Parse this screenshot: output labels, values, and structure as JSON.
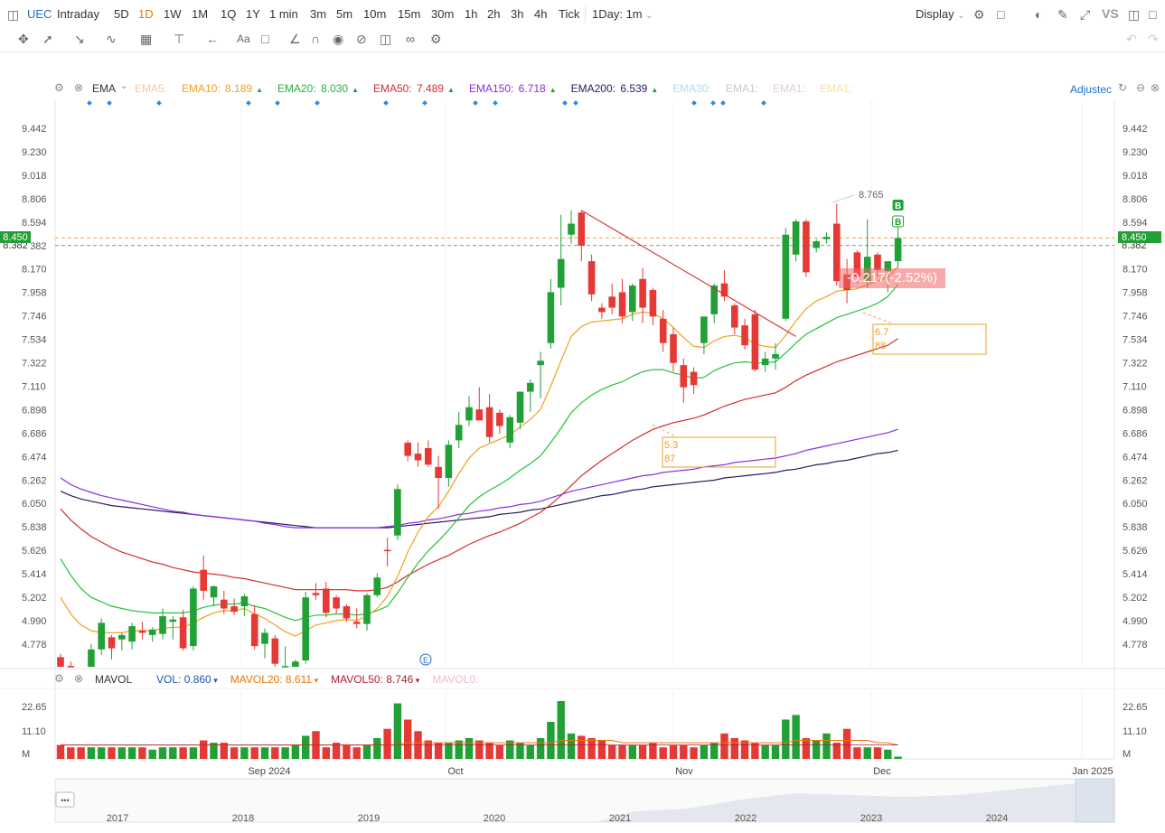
{
  "toolbar": {
    "symbol": "UEC",
    "timeframes": [
      "Intraday",
      "5D",
      "1D",
      "1W",
      "1M",
      "1Q",
      "1Y",
      "1 min",
      "3m",
      "5m",
      "10m",
      "15m",
      "30m",
      "1h",
      "2h",
      "3h",
      "4h",
      "Tick"
    ],
    "active_timeframe": "1D",
    "interval_select": "1Day: 1m",
    "display_label": "Display",
    "vs_label": "VS",
    "accent_color": "#e8760b"
  },
  "indicator_bar": {
    "name": "EMA",
    "items": [
      {
        "label": "EMA5:",
        "value": "",
        "color": "#f5c8a0"
      },
      {
        "label": "EMA10:",
        "value": "8.189",
        "color": "#f0a020",
        "arrow": "up"
      },
      {
        "label": "EMA20:",
        "value": "8.030",
        "color": "#22b33a",
        "arrow": "up"
      },
      {
        "label": "EMA50:",
        "value": "7.489",
        "color": "#d42c2c",
        "arrow": "up"
      },
      {
        "label": "EMA150:",
        "value": "6.718",
        "color": "#8a2be2",
        "arrow": "up"
      },
      {
        "label": "EMA200:",
        "value": "6.539",
        "color": "#2a1a5e",
        "arrow": "up"
      },
      {
        "label": "EMA30:",
        "value": "",
        "color": "#a8e0f0"
      },
      {
        "label": "EMA1:",
        "value": "",
        "color": "#c8c8c8"
      },
      {
        "label": "EMA1:",
        "value": "",
        "color": "#e8c8d8"
      },
      {
        "label": "EMA1:",
        "value": "",
        "color": "#f5e0a0"
      }
    ],
    "adjusted_label": "Adjustec"
  },
  "volume_bar": {
    "name": "MAVOL",
    "items": [
      {
        "label": "VOL:",
        "value": "0.860",
        "color": "#1a55b5"
      },
      {
        "label": "MAVOL20:",
        "value": "8.611",
        "color": "#e8760b"
      },
      {
        "label": "MAVOL50:",
        "value": "8.746",
        "color": "#b01c2e"
      },
      {
        "label": "MAVOL0:",
        "value": "",
        "color": "#f0b8c8"
      }
    ]
  },
  "price_tags": {
    "last_price": "8.450",
    "last_price_color": "#21a035",
    "left_tag_color": "#21a035",
    "right_tag_overlap": "8.382",
    "change_label": "-0.217(-2.52%)",
    "high_label": "8.765"
  },
  "annotations": {
    "box1": [
      "5.3",
      "87"
    ],
    "box2": [
      "6.7",
      "88"
    ],
    "markers": [
      "B",
      "B"
    ],
    "event_icon": "E"
  },
  "navigator": {
    "years": [
      "2017",
      "2018",
      "2019",
      "2020",
      "2021",
      "2022",
      "2023",
      "2024"
    ],
    "menu": "•••"
  },
  "chart_data": {
    "type": "candlestick",
    "price_axis_ticks": [
      9.442,
      9.23,
      9.018,
      8.806,
      8.594,
      8.382,
      8.17,
      7.958,
      7.746,
      7.534,
      7.322,
      7.11,
      6.898,
      6.686,
      6.474,
      6.262,
      6.05,
      5.838,
      5.626,
      5.414,
      5.202,
      4.99,
      4.778
    ],
    "volume_axis_ticks": [
      "22.65",
      "11.10",
      "M"
    ],
    "x_axis_labels": [
      "Sep 2024",
      "Oct",
      "Nov",
      "Dec",
      "Jan 2025"
    ],
    "up_color": "#21a035",
    "down_color": "#e53935",
    "candles": [
      {
        "o": 4.66,
        "h": 4.69,
        "l": 4.38,
        "c": 4.44
      },
      {
        "o": 4.58,
        "h": 4.62,
        "l": 4.38,
        "c": 4.43
      },
      {
        "o": 4.54,
        "h": 4.62,
        "l": 4.29,
        "c": 4.36
      },
      {
        "o": 4.4,
        "h": 4.78,
        "l": 4.35,
        "c": 4.73
      },
      {
        "o": 4.73,
        "h": 5.01,
        "l": 4.68,
        "c": 4.97
      },
      {
        "o": 4.84,
        "h": 4.86,
        "l": 4.64,
        "c": 4.74
      },
      {
        "o": 4.82,
        "h": 4.88,
        "l": 4.72,
        "c": 4.86
      },
      {
        "o": 4.8,
        "h": 4.97,
        "l": 4.73,
        "c": 4.94
      },
      {
        "o": 4.9,
        "h": 4.98,
        "l": 4.82,
        "c": 4.88
      },
      {
        "o": 4.86,
        "h": 4.93,
        "l": 4.8,
        "c": 4.91
      },
      {
        "o": 4.87,
        "h": 5.1,
        "l": 4.82,
        "c": 5.03
      },
      {
        "o": 4.98,
        "h": 5.03,
        "l": 4.82,
        "c": 5.0
      },
      {
        "o": 5.02,
        "h": 5.09,
        "l": 4.72,
        "c": 4.74
      },
      {
        "o": 4.76,
        "h": 5.3,
        "l": 4.72,
        "c": 5.28
      },
      {
        "o": 5.45,
        "h": 5.58,
        "l": 5.18,
        "c": 5.26
      },
      {
        "o": 5.2,
        "h": 5.31,
        "l": 5.12,
        "c": 5.3
      },
      {
        "o": 5.18,
        "h": 5.26,
        "l": 5.05,
        "c": 5.1
      },
      {
        "o": 5.12,
        "h": 5.19,
        "l": 5.04,
        "c": 5.07
      },
      {
        "o": 5.12,
        "h": 5.23,
        "l": 5.03,
        "c": 5.21
      },
      {
        "o": 5.05,
        "h": 5.13,
        "l": 4.73,
        "c": 4.76
      },
      {
        "o": 4.78,
        "h": 4.92,
        "l": 4.65,
        "c": 4.88
      },
      {
        "o": 4.83,
        "h": 4.86,
        "l": 4.54,
        "c": 4.6
      },
      {
        "o": 4.58,
        "h": 4.76,
        "l": 4.4,
        "c": 4.58
      },
      {
        "o": 4.52,
        "h": 4.64,
        "l": 4.42,
        "c": 4.62
      },
      {
        "o": 4.63,
        "h": 5.25,
        "l": 4.6,
        "c": 5.2
      },
      {
        "o": 5.24,
        "h": 5.33,
        "l": 5.18,
        "c": 5.22
      },
      {
        "o": 5.28,
        "h": 5.34,
        "l": 5.02,
        "c": 5.06
      },
      {
        "o": 5.2,
        "h": 5.22,
        "l": 5.05,
        "c": 5.1
      },
      {
        "o": 5.12,
        "h": 5.14,
        "l": 4.98,
        "c": 5.01
      },
      {
        "o": 4.98,
        "h": 5.1,
        "l": 4.92,
        "c": 4.96
      },
      {
        "o": 4.96,
        "h": 5.24,
        "l": 4.9,
        "c": 5.22
      },
      {
        "o": 5.22,
        "h": 5.42,
        "l": 5.2,
        "c": 5.38
      },
      {
        "o": 5.63,
        "h": 5.74,
        "l": 5.48,
        "c": 5.62
      },
      {
        "o": 5.76,
        "h": 6.22,
        "l": 5.72,
        "c": 6.18
      },
      {
        "o": 6.6,
        "h": 6.62,
        "l": 6.43,
        "c": 6.48
      },
      {
        "o": 6.5,
        "h": 6.6,
        "l": 6.38,
        "c": 6.44
      },
      {
        "o": 6.55,
        "h": 6.62,
        "l": 6.38,
        "c": 6.4
      },
      {
        "o": 6.38,
        "h": 6.48,
        "l": 6.0,
        "c": 6.28
      },
      {
        "o": 6.28,
        "h": 6.62,
        "l": 6.2,
        "c": 6.58
      },
      {
        "o": 6.62,
        "h": 6.88,
        "l": 6.55,
        "c": 6.76
      },
      {
        "o": 6.8,
        "h": 7.02,
        "l": 6.75,
        "c": 6.92
      },
      {
        "o": 6.9,
        "h": 7.1,
        "l": 6.82,
        "c": 6.8
      },
      {
        "o": 6.92,
        "h": 7.04,
        "l": 6.6,
        "c": 6.65
      },
      {
        "o": 6.87,
        "h": 6.9,
        "l": 6.68,
        "c": 6.75
      },
      {
        "o": 6.6,
        "h": 6.85,
        "l": 6.55,
        "c": 6.83
      },
      {
        "o": 6.78,
        "h": 7.06,
        "l": 6.72,
        "c": 7.06
      },
      {
        "o": 7.06,
        "h": 7.17,
        "l": 6.88,
        "c": 7.14
      },
      {
        "o": 7.3,
        "h": 7.42,
        "l": 7.0,
        "c": 7.34
      },
      {
        "o": 7.5,
        "h": 8.08,
        "l": 7.45,
        "c": 7.96
      },
      {
        "o": 8.0,
        "h": 8.66,
        "l": 7.84,
        "c": 8.26
      },
      {
        "o": 8.48,
        "h": 8.7,
        "l": 8.4,
        "c": 8.58
      },
      {
        "o": 8.68,
        "h": 8.7,
        "l": 8.24,
        "c": 8.38
      },
      {
        "o": 8.24,
        "h": 8.3,
        "l": 7.88,
        "c": 7.94
      },
      {
        "o": 7.82,
        "h": 7.86,
        "l": 7.72,
        "c": 7.78
      },
      {
        "o": 7.92,
        "h": 8.04,
        "l": 7.76,
        "c": 7.82
      },
      {
        "o": 7.96,
        "h": 8.08,
        "l": 7.68,
        "c": 7.74
      },
      {
        "o": 7.78,
        "h": 8.04,
        "l": 7.7,
        "c": 8.02
      },
      {
        "o": 8.08,
        "h": 8.18,
        "l": 7.68,
        "c": 7.82
      },
      {
        "o": 7.98,
        "h": 8.0,
        "l": 7.66,
        "c": 7.74
      },
      {
        "o": 7.72,
        "h": 7.8,
        "l": 7.42,
        "c": 7.5
      },
      {
        "o": 7.58,
        "h": 7.64,
        "l": 7.24,
        "c": 7.32
      },
      {
        "o": 7.3,
        "h": 7.36,
        "l": 6.96,
        "c": 7.1
      },
      {
        "o": 7.24,
        "h": 7.28,
        "l": 7.04,
        "c": 7.12
      },
      {
        "o": 7.5,
        "h": 7.62,
        "l": 7.4,
        "c": 7.74
      },
      {
        "o": 7.76,
        "h": 8.04,
        "l": 7.68,
        "c": 8.02
      },
      {
        "o": 8.04,
        "h": 8.16,
        "l": 7.88,
        "c": 7.92
      },
      {
        "o": 7.84,
        "h": 7.86,
        "l": 7.58,
        "c": 7.64
      },
      {
        "o": 7.66,
        "h": 7.72,
        "l": 7.44,
        "c": 7.48
      },
      {
        "o": 7.76,
        "h": 7.8,
        "l": 7.24,
        "c": 7.26
      },
      {
        "o": 7.3,
        "h": 7.42,
        "l": 7.24,
        "c": 7.36
      },
      {
        "o": 7.36,
        "h": 7.5,
        "l": 7.26,
        "c": 7.4
      },
      {
        "o": 7.72,
        "h": 8.54,
        "l": 7.7,
        "c": 8.48
      },
      {
        "o": 8.3,
        "h": 8.62,
        "l": 8.24,
        "c": 8.6
      },
      {
        "o": 8.6,
        "h": 8.62,
        "l": 8.1,
        "c": 8.14
      },
      {
        "o": 8.36,
        "h": 8.44,
        "l": 8.32,
        "c": 8.42
      },
      {
        "o": 8.44,
        "h": 8.5,
        "l": 8.4,
        "c": 8.46
      },
      {
        "o": 8.58,
        "h": 8.76,
        "l": 8.02,
        "c": 8.06
      },
      {
        "o": 8.12,
        "h": 8.26,
        "l": 7.86,
        "c": 7.98
      },
      {
        "o": 8.32,
        "h": 8.34,
        "l": 8.04,
        "c": 8.1
      },
      {
        "o": 8.06,
        "h": 8.62,
        "l": 8.0,
        "c": 8.28
      },
      {
        "o": 8.3,
        "h": 8.32,
        "l": 8.1,
        "c": 8.16
      },
      {
        "o": 8.15,
        "h": 8.24,
        "l": 7.96,
        "c": 8.24
      },
      {
        "o": 8.24,
        "h": 8.56,
        "l": 8.18,
        "c": 8.45
      }
    ],
    "volume": [
      6,
      5,
      5,
      5,
      5,
      5,
      5,
      5,
      5,
      4,
      5,
      5,
      5,
      5,
      8,
      7,
      7,
      5,
      5,
      5,
      5,
      5,
      5,
      6,
      10,
      12,
      5,
      7,
      6,
      5,
      6,
      9,
      13,
      24,
      17,
      12,
      8,
      7,
      7,
      8,
      9,
      8,
      7,
      6,
      8,
      7,
      6,
      9,
      16,
      25,
      11,
      10,
      9,
      8,
      6,
      6,
      6,
      6,
      7,
      5,
      6,
      6,
      5,
      6,
      7,
      11,
      9,
      8,
      7,
      6,
      6,
      17,
      19,
      9,
      8,
      11,
      7,
      13,
      5,
      5,
      5,
      4,
      1
    ],
    "volume_colors": "same as candle direction",
    "ema_series": [
      {
        "name": "EMA10",
        "color": "#f0a020"
      },
      {
        "name": "EMA20",
        "color": "#22c33a"
      },
      {
        "name": "EMA50",
        "color": "#d42c2c"
      },
      {
        "name": "EMA150",
        "color": "#8a2be2"
      },
      {
        "name": "EMA200",
        "color": "#2a1a5e"
      }
    ],
    "ema_values": {
      "EMA10": [
        5.2,
        5.05,
        4.95,
        4.9,
        4.88,
        4.88,
        4.88,
        4.9,
        4.9,
        4.9,
        4.92,
        4.93,
        4.93,
        4.97,
        5.02,
        5.06,
        5.08,
        5.08,
        5.1,
        5.05,
        5.01,
        4.95,
        4.89,
        4.85,
        4.9,
        4.95,
        4.97,
        4.99,
        5.0,
        4.99,
        5.03,
        5.1,
        5.21,
        5.39,
        5.61,
        5.79,
        5.93,
        6.02,
        6.16,
        6.32,
        6.46,
        6.55,
        6.59,
        6.63,
        6.67,
        6.74,
        6.81,
        6.9,
        7.11,
        7.34,
        7.56,
        7.65,
        7.69,
        7.7,
        7.71,
        7.72,
        7.76,
        7.78,
        7.77,
        7.72,
        7.64,
        7.55,
        7.47,
        7.46,
        7.52,
        7.56,
        7.57,
        7.55,
        7.49,
        7.47,
        7.46,
        7.57,
        7.7,
        7.81,
        7.88,
        7.92,
        7.97,
        7.98,
        7.99,
        8.03,
        8.06,
        8.1,
        8.19
      ],
      "EMA20": [
        5.55,
        5.4,
        5.28,
        5.2,
        5.16,
        5.12,
        5.1,
        5.08,
        5.07,
        5.06,
        5.06,
        5.06,
        5.06,
        5.08,
        5.11,
        5.13,
        5.14,
        5.14,
        5.15,
        5.12,
        5.1,
        5.06,
        5.02,
        4.99,
        5.02,
        5.04,
        5.04,
        5.05,
        5.05,
        5.04,
        5.05,
        5.08,
        5.12,
        5.24,
        5.38,
        5.51,
        5.62,
        5.71,
        5.81,
        5.92,
        6.03,
        6.11,
        6.17,
        6.22,
        6.28,
        6.35,
        6.41,
        6.48,
        6.6,
        6.73,
        6.87,
        6.96,
        7.03,
        7.08,
        7.12,
        7.15,
        7.2,
        7.24,
        7.26,
        7.26,
        7.23,
        7.21,
        7.18,
        7.19,
        7.25,
        7.29,
        7.32,
        7.33,
        7.32,
        7.32,
        7.33,
        7.41,
        7.5,
        7.58,
        7.63,
        7.68,
        7.73,
        7.76,
        7.79,
        7.82,
        7.86,
        7.92,
        8.03
      ],
      "EMA50": [
        6.0,
        5.9,
        5.82,
        5.75,
        5.7,
        5.65,
        5.61,
        5.58,
        5.55,
        5.52,
        5.5,
        5.47,
        5.45,
        5.43,
        5.42,
        5.41,
        5.4,
        5.38,
        5.37,
        5.35,
        5.33,
        5.31,
        5.29,
        5.27,
        5.27,
        5.27,
        5.27,
        5.27,
        5.27,
        5.26,
        5.26,
        5.27,
        5.29,
        5.34,
        5.4,
        5.45,
        5.5,
        5.54,
        5.58,
        5.63,
        5.68,
        5.72,
        5.76,
        5.79,
        5.83,
        5.87,
        5.92,
        5.97,
        6.04,
        6.12,
        6.21,
        6.3,
        6.37,
        6.44,
        6.5,
        6.56,
        6.62,
        6.67,
        6.72,
        6.75,
        6.78,
        6.8,
        6.82,
        6.85,
        6.89,
        6.93,
        6.96,
        6.99,
        7.01,
        7.03,
        7.05,
        7.1,
        7.16,
        7.21,
        7.25,
        7.29,
        7.33,
        7.36,
        7.39,
        7.42,
        7.45,
        7.48,
        7.54
      ],
      "EMA150": [
        6.28,
        6.22,
        6.18,
        6.15,
        6.12,
        6.1,
        6.08,
        6.06,
        6.04,
        6.02,
        6.0,
        5.98,
        5.97,
        5.95,
        5.94,
        5.93,
        5.92,
        5.91,
        5.9,
        5.89,
        5.87,
        5.86,
        5.84,
        5.83,
        5.83,
        5.83,
        5.83,
        5.83,
        5.83,
        5.83,
        5.83,
        5.83,
        5.84,
        5.85,
        5.87,
        5.88,
        5.9,
        5.91,
        5.93,
        5.95,
        5.96,
        5.98,
        5.99,
        6.01,
        6.02,
        6.04,
        6.05,
        6.07,
        6.1,
        6.13,
        6.16,
        6.18,
        6.2,
        6.22,
        6.24,
        6.26,
        6.28,
        6.3,
        6.31,
        6.33,
        6.34,
        6.35,
        6.36,
        6.38,
        6.39,
        6.4,
        6.42,
        6.43,
        6.44,
        6.45,
        6.46,
        6.48,
        6.5,
        6.53,
        6.55,
        6.57,
        6.59,
        6.61,
        6.63,
        6.65,
        6.67,
        6.69,
        6.72
      ],
      "EMA200": [
        6.16,
        6.12,
        6.09,
        6.07,
        6.05,
        6.03,
        6.02,
        6.01,
        6.0,
        5.99,
        5.98,
        5.97,
        5.96,
        5.95,
        5.94,
        5.93,
        5.92,
        5.91,
        5.9,
        5.89,
        5.88,
        5.87,
        5.86,
        5.85,
        5.84,
        5.83,
        5.83,
        5.83,
        5.83,
        5.83,
        5.83,
        5.83,
        5.83,
        5.84,
        5.85,
        5.86,
        5.87,
        5.88,
        5.89,
        5.9,
        5.91,
        5.92,
        5.93,
        5.95,
        5.96,
        5.97,
        5.99,
        6.0,
        6.02,
        6.04,
        6.06,
        6.08,
        6.1,
        6.12,
        6.13,
        6.15,
        6.17,
        6.18,
        6.2,
        6.21,
        6.22,
        6.23,
        6.24,
        6.25,
        6.26,
        6.28,
        6.29,
        6.3,
        6.31,
        6.32,
        6.33,
        6.35,
        6.36,
        6.38,
        6.4,
        6.41,
        6.43,
        6.44,
        6.46,
        6.48,
        6.5,
        6.51,
        6.53
      ]
    },
    "mavol20": [
      6,
      6,
      6,
      6,
      6,
      6,
      6,
      6,
      6,
      6,
      6,
      6,
      6,
      6,
      6,
      6,
      6,
      6,
      6,
      6,
      6,
      6,
      6,
      6,
      6,
      6,
      6,
      6,
      6,
      6,
      6,
      6,
      6,
      6,
      7,
      7,
      7,
      7,
      7,
      7,
      7,
      7,
      7,
      7,
      7,
      7,
      7,
      7,
      7,
      8,
      8,
      8,
      8,
      8,
      8,
      7,
      7,
      7,
      7,
      7,
      7,
      7,
      7,
      7,
      7,
      7,
      7,
      7,
      7,
      7,
      7,
      7,
      8,
      8,
      8,
      8,
      8,
      8,
      8,
      8,
      7,
      7,
      6
    ],
    "mavol50_value": 6,
    "trendline": {
      "from_candle": 51,
      "from_price": 8.7,
      "to_candle": 72,
      "to_price": 7.56
    }
  }
}
